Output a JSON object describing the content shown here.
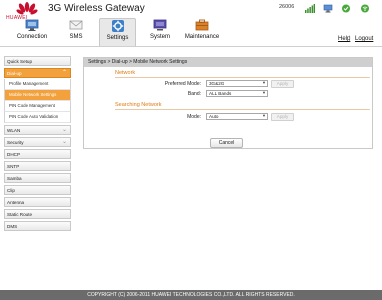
{
  "header": {
    "brand_word": "HUAWEI",
    "title": "3G Wireless Gateway",
    "signal_code": "26006",
    "status_icons": [
      "signal-bars-icon",
      "pc-connection-icon",
      "globe-online-icon",
      "wifi-icon"
    ],
    "tabs": [
      {
        "label": "Connection",
        "icon": "connection-icon",
        "active": false
      },
      {
        "label": "SMS",
        "icon": "envelope-icon",
        "active": false
      },
      {
        "label": "Settings",
        "icon": "gear-icon",
        "active": true
      },
      {
        "label": "System",
        "icon": "computer-icon",
        "active": false
      },
      {
        "label": "Maintenance",
        "icon": "toolbox-icon",
        "active": false
      }
    ],
    "help_link": "Help",
    "separator": "|",
    "logout_link": "Logout"
  },
  "sidebar": {
    "items": [
      {
        "label": "Quick Setup"
      },
      {
        "label": "Dial-up",
        "open": true,
        "children": [
          {
            "label": "Profile Management",
            "selected": false
          },
          {
            "label": "Mobile Network Settings",
            "selected": true
          },
          {
            "label": "PIN Code Management",
            "selected": false
          },
          {
            "label": "PIN Code Auto Validation",
            "selected": false
          }
        ]
      },
      {
        "label": "WLAN"
      },
      {
        "label": "Security"
      },
      {
        "label": "DHCP"
      },
      {
        "label": "SNTP"
      },
      {
        "label": "Samba"
      },
      {
        "label": "Clip"
      },
      {
        "label": "Antenna"
      },
      {
        "label": "Static Route"
      },
      {
        "label": "DMS"
      }
    ]
  },
  "main": {
    "breadcrumb": "Settings > Dial-up > Mobile Network Settings",
    "network": {
      "title": "Network",
      "preferred_mode_label": "Preferred Mode:",
      "preferred_mode_value": "3G&2G",
      "band_label": "Band:",
      "band_value": "ALL Bands",
      "apply_label": "Apply"
    },
    "searching": {
      "title": "Searching Network",
      "mode_label": "Mode:",
      "mode_value": "Auto",
      "apply_label": "Apply"
    },
    "cancel_label": "Cancel"
  },
  "footer": {
    "copyright": "COPYRIGHT (C) 2006-2011 HUAWEI TECHNOLOGIES CO.,LTD. ALL RIGHTS RESERVED."
  },
  "colors": {
    "accent_orange": "#F2A13C",
    "section_orange": "#E07A12",
    "footer_gray": "#6B6B6B",
    "brand_red": "#C8102E"
  }
}
